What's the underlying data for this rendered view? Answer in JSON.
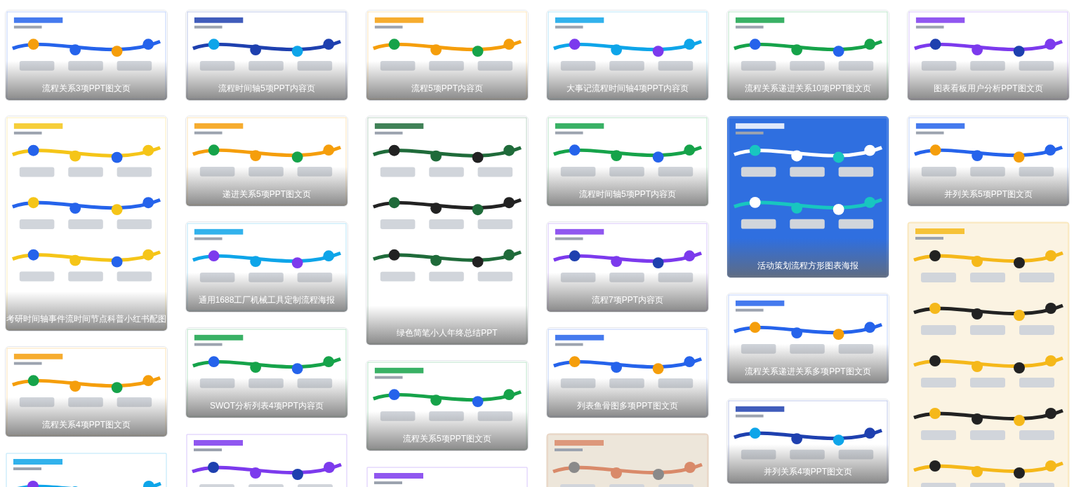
{
  "columns": [
    {
      "cards": [
        {
          "caption": "流程关系3项PPT图文页"
        },
        {
          "caption": "考研时间轴事件流时间节点科普小红书配图"
        },
        {
          "caption": "流程关系4项PPT图文页"
        },
        {
          "kind": "picture"
        }
      ]
    },
    {
      "cards": [
        {
          "caption": "流程时间轴5项PPT内容页"
        },
        {
          "caption": "递进关系5项PPT图文页"
        },
        {
          "caption": "通用1688工厂机械工具定制流程海报"
        },
        {
          "caption": "SWOT分析列表4项PPT内容页"
        },
        {
          "kind": "picture"
        }
      ]
    },
    {
      "cards": [
        {
          "caption": "流程5项PPT内容页"
        },
        {
          "caption": "绿色简笔小人年终总结PPT"
        },
        {
          "caption": "流程关系5项PPT图文页"
        },
        {
          "kind": "picture"
        }
      ]
    },
    {
      "cards": [
        {
          "caption": "大事记流程时间轴4项PPT内容页"
        },
        {
          "caption": "流程时间轴5项PPT内容页"
        },
        {
          "caption": "流程7项PPT内容页"
        },
        {
          "caption": "列表鱼骨图多项PPT图文页"
        },
        {
          "kind": "picture"
        }
      ]
    },
    {
      "cards": [
        {
          "caption": "流程关系递进关系10项PPT图文页"
        },
        {
          "caption": "活动策划流程方形图表海报"
        },
        {
          "caption": "流程关系递进关系多项PPT图文页"
        },
        {
          "caption": "并列关系4项PPT图文页"
        }
      ]
    },
    {
      "cards": [
        {
          "caption": "图表看板用户分析PPT图文页"
        },
        {
          "caption": "并列关系5项PPT图文页"
        },
        {
          "kind": "picture"
        }
      ]
    }
  ]
}
